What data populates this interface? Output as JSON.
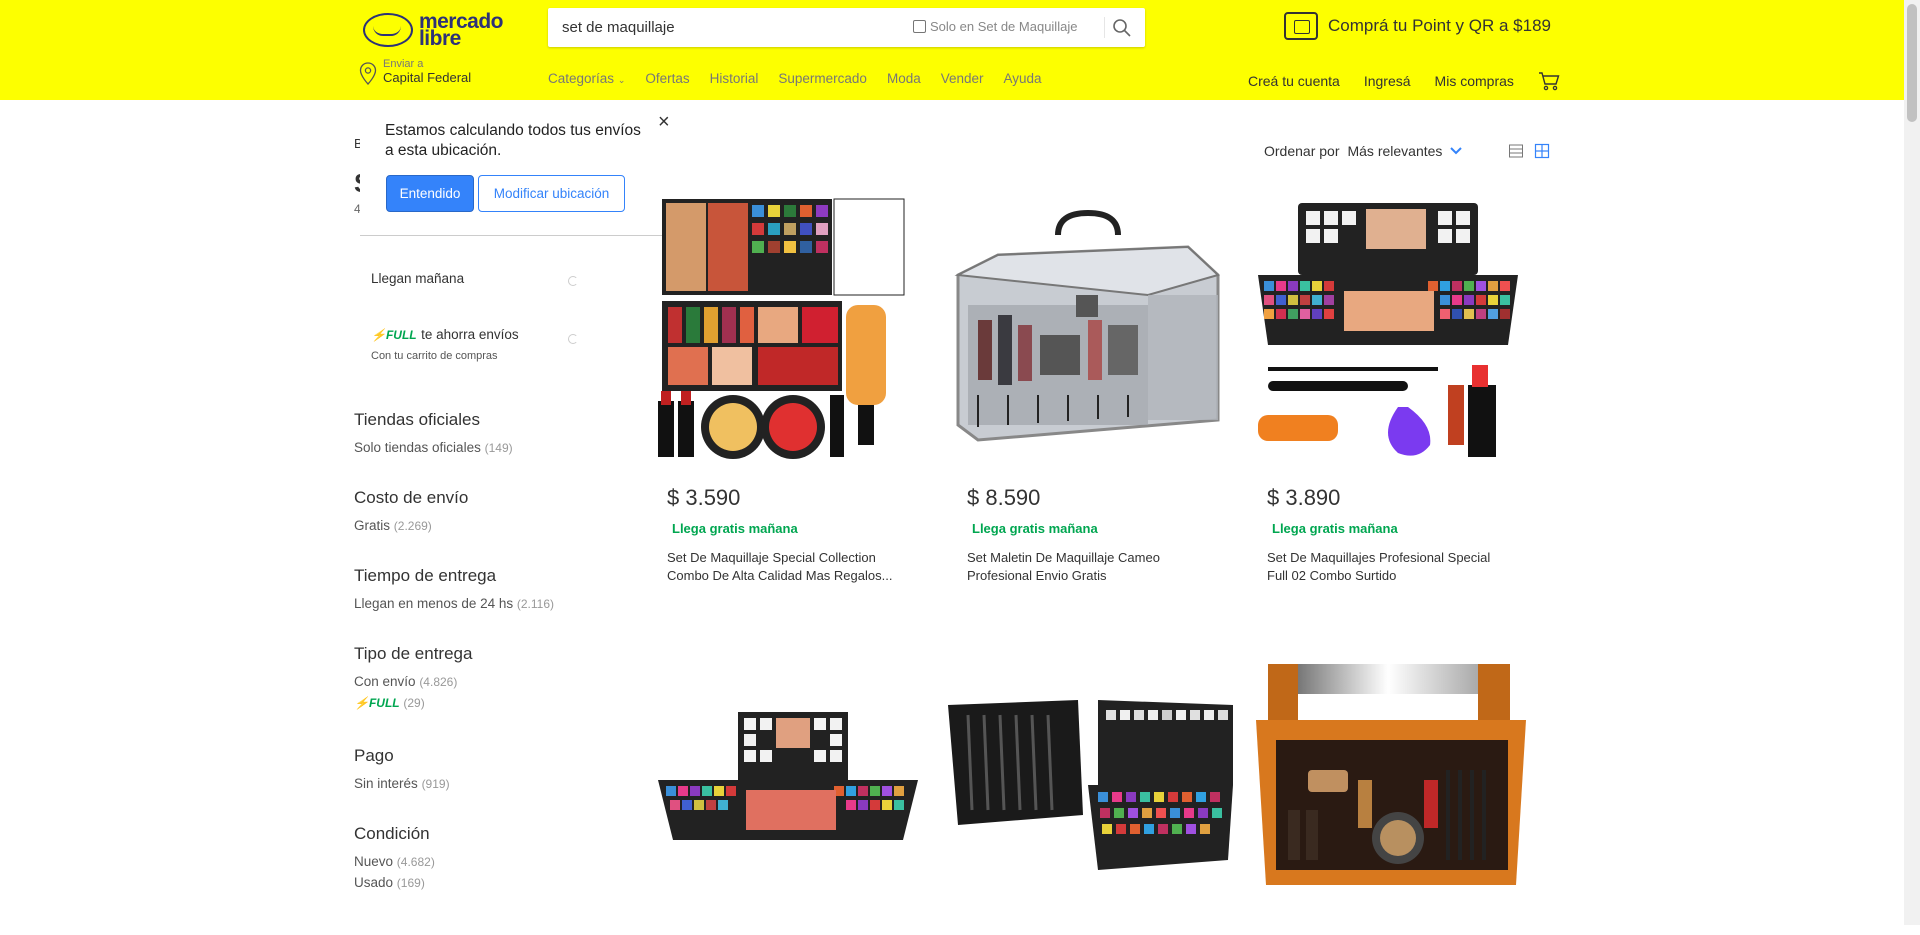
{
  "header": {
    "logo_line1": "mercado",
    "logo_line2": "libre",
    "search_value": "set de maquillaje",
    "search_checkbox_label": "Solo en Set de Maquillaje",
    "promo_text": "Comprá tu Point y QR a $189",
    "location_label": "Enviar a",
    "location_value": "Capital Federal",
    "nav": [
      "Categorías",
      "Ofertas",
      "Historial",
      "Supermercado",
      "Moda",
      "Vender",
      "Ayuda"
    ],
    "user_nav": [
      "Creá tu cuenta",
      "Ingresá",
      "Mis compras"
    ],
    "colors": {
      "brand_yellow": "#fdff00",
      "brand_blue": "#2d3277",
      "accent": "#3483fa",
      "success": "#00a650"
    }
  },
  "location_tooltip": {
    "message": "Estamos calculando todos tus envíos a esta ubicación.",
    "close": "×",
    "confirm_button": "Entendido",
    "modify_button": "Modificar ubicación"
  },
  "behind_tooltip": {
    "breadcrumb_peek": "B",
    "title_peek": "S",
    "count_peek": "4"
  },
  "sidebar": {
    "toggles": [
      {
        "label": "Llegan mañana"
      },
      {
        "label_badge": "FULL",
        "label": "te ahorra envíos",
        "sub": "Con tu carrito de compras"
      }
    ],
    "filters": [
      {
        "title": "Tiendas oficiales",
        "items": [
          {
            "label": "Solo tiendas oficiales",
            "count": "(149)"
          }
        ]
      },
      {
        "title": "Costo de envío",
        "items": [
          {
            "label": "Gratis",
            "count": "(2.269)"
          }
        ]
      },
      {
        "title": "Tiempo de entrega",
        "items": [
          {
            "label": "Llegan en menos de 24 hs",
            "count": "(2.116)"
          }
        ]
      },
      {
        "title": "Tipo de entrega",
        "items": [
          {
            "label": "Con envío",
            "count": "(4.826)"
          },
          {
            "label": "FULL",
            "count": "(29)"
          }
        ]
      },
      {
        "title": "Pago",
        "items": [
          {
            "label": "Sin interés",
            "count": "(919)"
          }
        ]
      },
      {
        "title": "Condición",
        "items": [
          {
            "label": "Nuevo",
            "count": "(4.682)"
          },
          {
            "label": "Usado",
            "count": "(169)"
          }
        ]
      }
    ]
  },
  "sort": {
    "label": "Ordenar por",
    "value": "Más relevantes"
  },
  "products": [
    {
      "price": "$ 3.590",
      "shipping": "Llega gratis mañana",
      "title": "Set De Maquillaje Special Collection Combo De Alta Calidad Mas Regalos..."
    },
    {
      "price": "$ 8.590",
      "shipping": "Llega gratis mañana",
      "title": "Set Maletin De Maquillaje Cameo Profesional Envio Gratis"
    },
    {
      "price": "$ 3.890",
      "shipping": "Llega gratis mañana",
      "title": "Set De Maquillajes Profesional Special Full 02 Combo Surtido"
    },
    {
      "price": "",
      "shipping": "",
      "title": ""
    },
    {
      "price": "",
      "shipping": "",
      "title": ""
    },
    {
      "price": "",
      "shipping": "",
      "title": ""
    }
  ]
}
